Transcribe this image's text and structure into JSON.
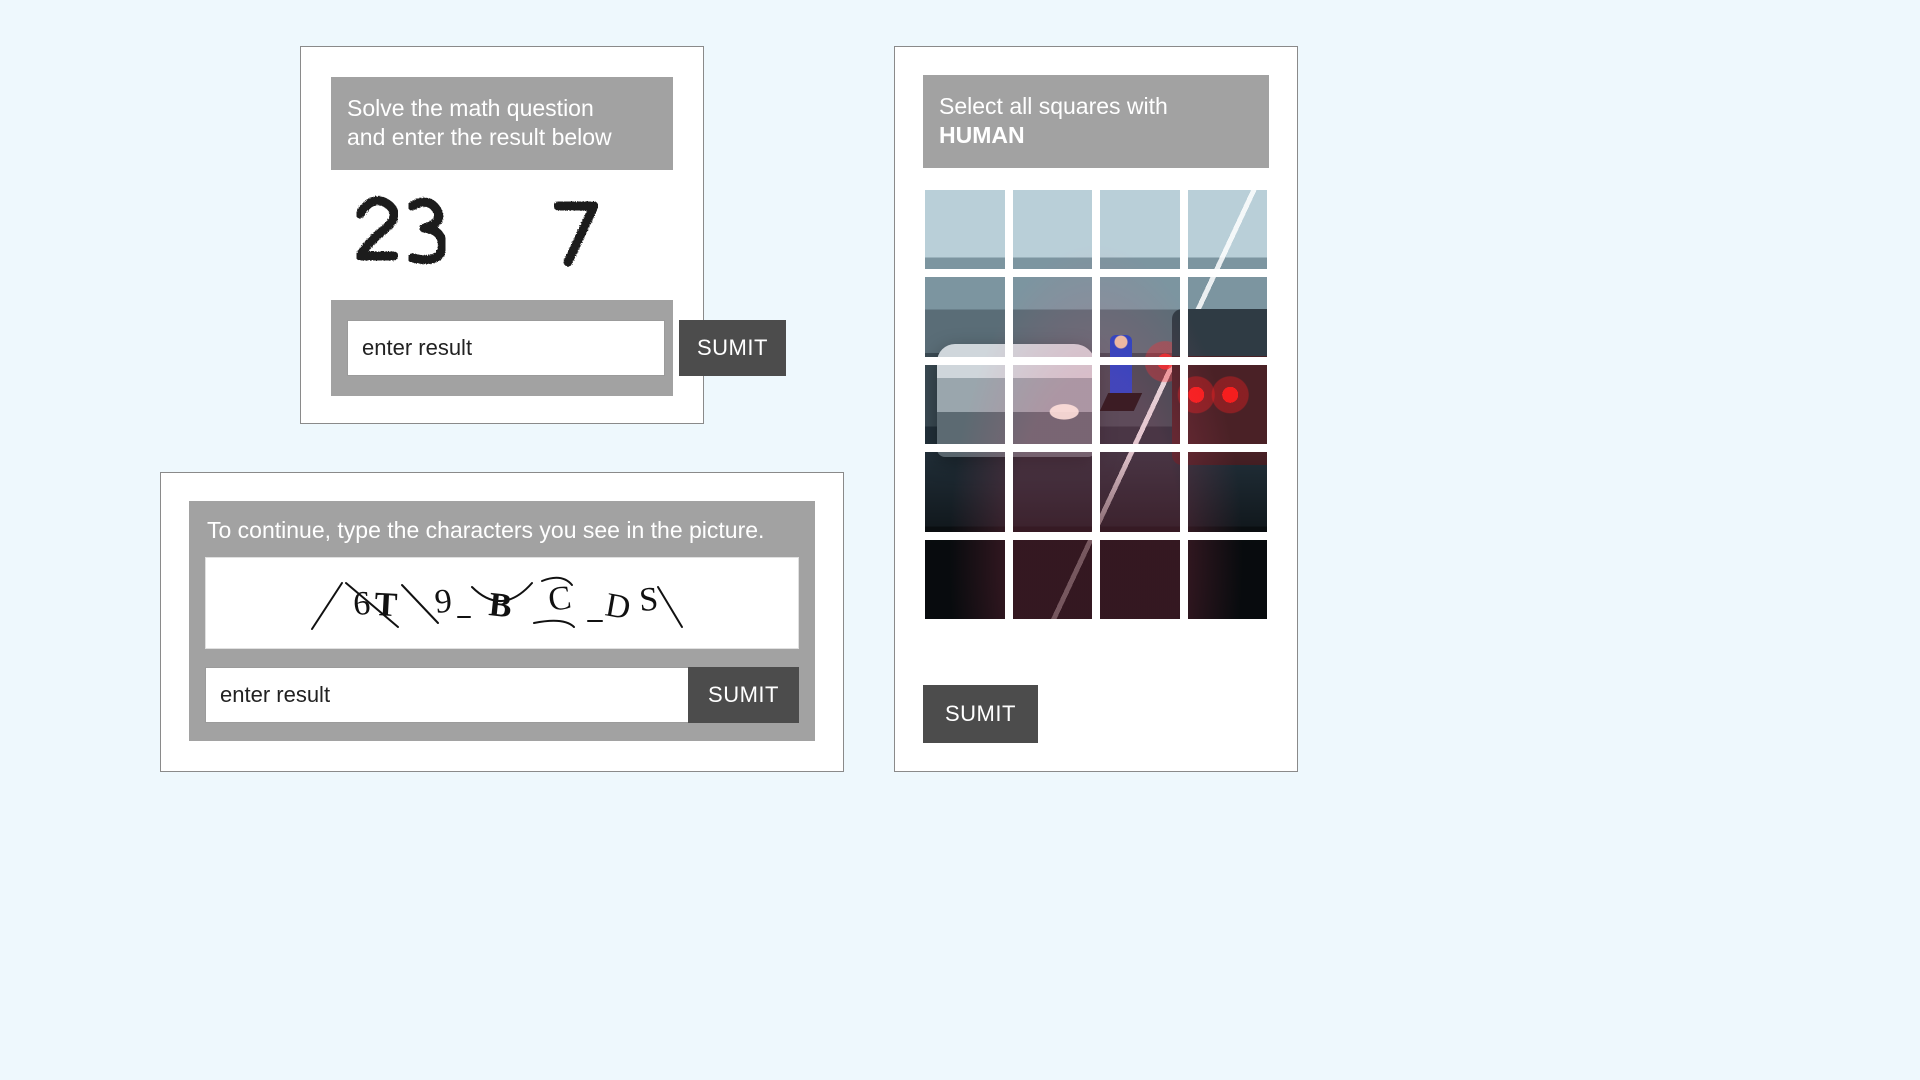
{
  "math": {
    "header_line1": "Solve the math question",
    "header_line2": "and enter the result below",
    "expression": "23 − 7 =",
    "placeholder": "enter result",
    "submit_label": "SUMIT"
  },
  "text": {
    "header": "To continue, type the characters you see in the picture.",
    "characters": "6T 9 B C D S",
    "placeholder": "enter result",
    "submit_label": "SUMIT"
  },
  "image": {
    "header_prefix": "Select all squares with",
    "target_word": "HUMAN",
    "submit_label": "SUMIT",
    "grid_rows": 5,
    "grid_cols": 4
  }
}
